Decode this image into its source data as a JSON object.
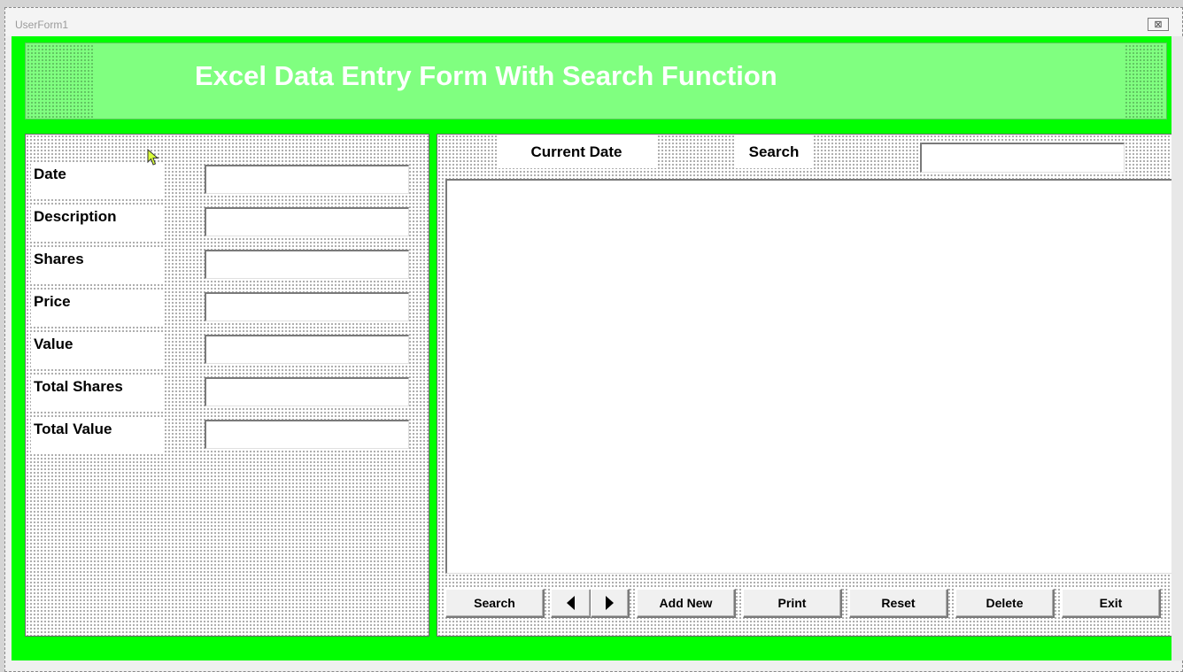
{
  "window": {
    "title": "UserForm1",
    "close_glyph": "⊠"
  },
  "header": {
    "title": "Excel Data Entry Form With Search Function",
    "background": "#80ff80",
    "frame_color": "#00ff00"
  },
  "form": {
    "fields": [
      {
        "label": "Date",
        "value": ""
      },
      {
        "label": "Description",
        "value": ""
      },
      {
        "label": "Shares",
        "value": ""
      },
      {
        "label": "Price",
        "value": ""
      },
      {
        "label": "Value",
        "value": ""
      },
      {
        "label": "Total Shares",
        "value": ""
      },
      {
        "label": "Total Value",
        "value": ""
      }
    ]
  },
  "search_area": {
    "current_date_label": "Current Date",
    "search_label": "Search",
    "search_value": ""
  },
  "buttons": {
    "search": "Search",
    "prev_icon": "arrow-left-icon",
    "next_icon": "arrow-right-icon",
    "add_new": "Add New",
    "print": "Print",
    "reset": "Reset",
    "delete": "Delete",
    "exit": "Exit"
  }
}
